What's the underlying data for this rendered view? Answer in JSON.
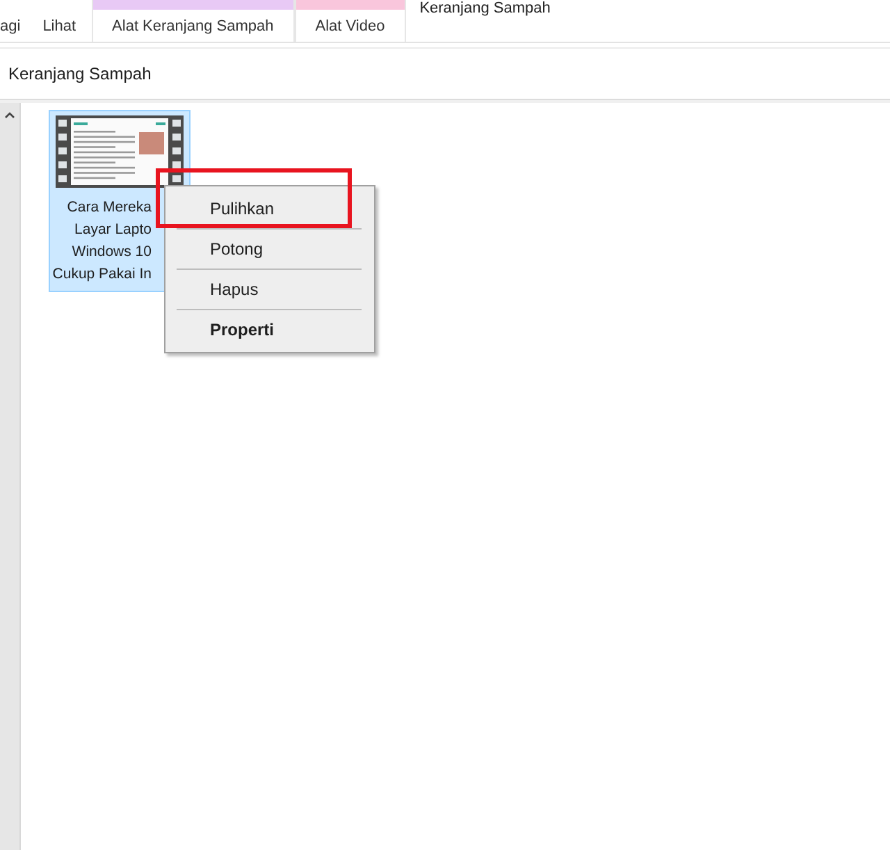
{
  "window": {
    "title": "Keranjang Sampah"
  },
  "ribbon_tabs": [
    {
      "label": "agi",
      "selected": false
    },
    {
      "label": "Lihat",
      "selected": false
    },
    {
      "label": "Alat Keranjang Sampah",
      "color": "#e8c9f5",
      "selected": false
    },
    {
      "label": "Alat Video",
      "color": "#f9c6dc",
      "selected": false
    }
  ],
  "address_bar": {
    "path": "Keranjang Sampah"
  },
  "files": [
    {
      "name_lines": [
        "Cara Mereka",
        "Layar Lapto",
        "Windows 10",
        "Cukup Pakai In"
      ],
      "selected": true
    }
  ],
  "context_menu": [
    {
      "label": "Pulihkan",
      "default": false,
      "highlighted": true
    },
    {
      "label": "Potong",
      "default": false,
      "highlighted": false
    },
    {
      "label": "Hapus",
      "default": false,
      "highlighted": false
    },
    {
      "label": "Properti",
      "default": true,
      "highlighted": false
    }
  ]
}
